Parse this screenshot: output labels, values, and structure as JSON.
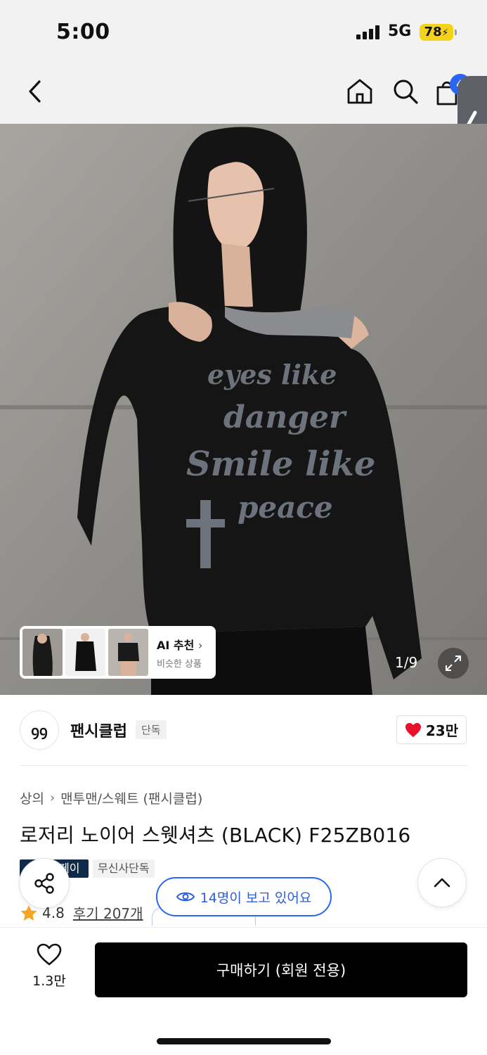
{
  "status_bar": {
    "time": "5:00",
    "network": "5G",
    "battery": "78"
  },
  "nav": {
    "back_icon": "chevron-left-icon",
    "home_icon": "home-icon",
    "search_icon": "search-icon",
    "cart_icon": "shopping-bag-icon",
    "cart_badge": "4"
  },
  "photo": {
    "counter": "1/9",
    "expand_icon": "expand-icon",
    "print_text": [
      "eyes like",
      "danger",
      "Smile like",
      "peace"
    ],
    "ai_card": {
      "title": "AI 추천",
      "subtitle": "비슷한 상품"
    }
  },
  "brand": {
    "logo_text": "ꝯꝯ",
    "name": "팬시클럽",
    "badge": "단독",
    "likes": "23만"
  },
  "product": {
    "breadcrumb": [
      "상의",
      "맨투맨/스웨트 (팬시클럽)"
    ],
    "title": "로저리 노이어 스웻셔츠 (BLACK) F25ZB016",
    "tags": [
      "페이",
      "무신사단독"
    ],
    "rating": "4.8",
    "reviews": "후기 207개"
  },
  "floating": {
    "viewers": "14명이 보고 있어요"
  },
  "bottom": {
    "wish_count": "1.3만",
    "buy_label": "구매하기 (회원 전용)"
  },
  "colors": {
    "accent_blue": "#2a66f5",
    "heart_red": "#e8102a",
    "star": "#f5a623",
    "buy_button": "#000000"
  }
}
